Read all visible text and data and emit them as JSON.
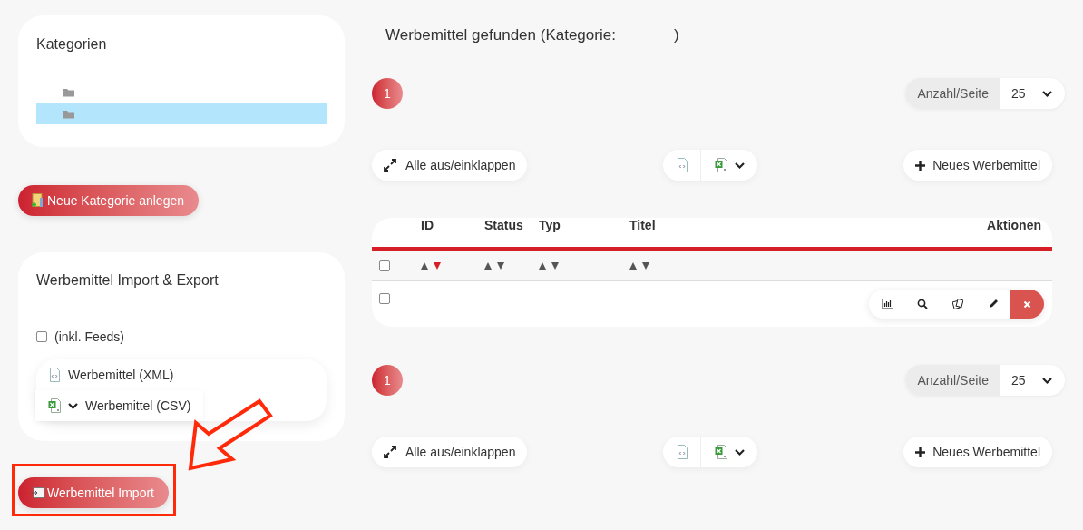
{
  "sidebar": {
    "categories": {
      "title": "Kategorien",
      "items": [
        {
          "selected": false
        },
        {
          "selected": true
        }
      ]
    },
    "new_category_button": "Neue Kategorie anlegen",
    "import_export": {
      "title": "Werbemittel Import & Export",
      "feeds_checkbox": {
        "label": "(inkl. Feeds)",
        "checked": false
      },
      "exports": [
        {
          "kind": "xml",
          "label": "Werbemittel (XML)"
        },
        {
          "kind": "csv",
          "label": "Werbemittel (CSV)"
        }
      ]
    },
    "import_button": "Werbemittel Import"
  },
  "main": {
    "heading": "Werbemittel gefunden (Kategorie:",
    "heading_close": ")",
    "sections": [
      {
        "pages": [
          {
            "label": "1",
            "selected": true
          }
        ],
        "per_page_label": "Anzahl/Seite",
        "per_page": "25",
        "collapse_button": "Alle aus/einklappen",
        "new_button": "Neues Werbemittel"
      },
      {
        "pages": [
          {
            "label": "1",
            "selected": true
          }
        ],
        "per_page_label": "Anzahl/Seite",
        "per_page": "25",
        "collapse_button": "Alle aus/einklappen",
        "new_button": "Neues Werbemittel"
      }
    ],
    "table": {
      "select_all": {
        "checked": false
      },
      "columns": [
        {
          "label": "ID",
          "sortable": true,
          "sorted_descending": true
        },
        {
          "label": "Status",
          "sortable": true,
          "sorted_descending": false
        },
        {
          "label": "Typ",
          "sortable": true,
          "sorted_descending": false
        },
        {
          "label": "Titel",
          "sortable": true,
          "sorted_descending": false
        },
        {
          "label": "Aktionen"
        }
      ],
      "rows": [
        {
          "checked": false
        }
      ]
    }
  }
}
